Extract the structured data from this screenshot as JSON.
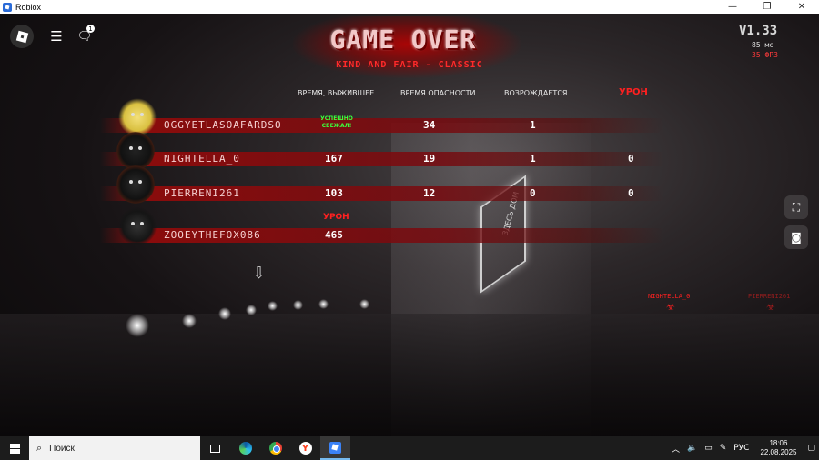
{
  "window": {
    "title": "Roblox",
    "controls": [
      "—",
      "❐",
      "✕"
    ]
  },
  "topbar": {
    "chat_badge": "1"
  },
  "header": {
    "title": "GAME OVER",
    "subtitle": "KIND AND FAIR - CLASSIC",
    "version": "V1.33",
    "ping": "85 мс",
    "fps": "35 ФРЗ"
  },
  "columns": {
    "time_survived": "ВРЕМЯ, ВЫЖИВШЕЕ",
    "danger_time": "ВРЕМЯ ОПАСНОСТИ",
    "revives": "ВОЗРОЖДАЕТСЯ",
    "damage": "УРОН"
  },
  "players": [
    {
      "name": "OGGYETLASOAFARDSO",
      "time": "",
      "status": "УСПЕШНО СБЕЖАЛ!",
      "danger": "34",
      "revives": "1",
      "damage": ""
    },
    {
      "name": "NIGHTELLA_0",
      "time": "167",
      "status": "",
      "danger": "19",
      "revives": "1",
      "damage": "0"
    },
    {
      "name": "PIERRENI261",
      "time": "103",
      "status": "",
      "danger": "12",
      "revives": "0",
      "damage": "0"
    },
    {
      "name": "ZOOEYTHEFOX086",
      "time": "465",
      "status": "",
      "danger": "",
      "revives": "",
      "damage": ""
    }
  ],
  "killer_row": {
    "damage_label": "УРОН"
  },
  "world": {
    "sign_text": "ЗДЕСЬ ДОМ",
    "nametags": [
      "NIGHTELLA_0",
      "PIERRENI261"
    ]
  },
  "taskbar": {
    "search_placeholder": "Поиск",
    "language": "РУС",
    "time": "18:06",
    "date": "22.08.2025"
  }
}
